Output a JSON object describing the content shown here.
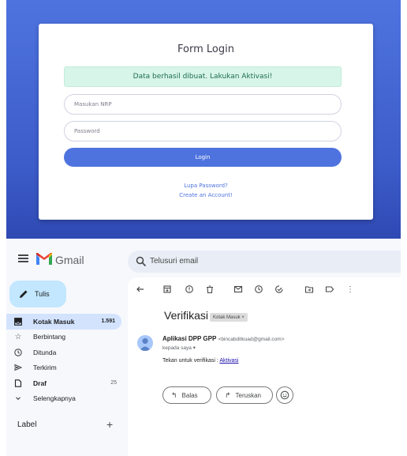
{
  "login": {
    "title": "Form Login",
    "alert": "Data berhasil dibuat. Lakukan Aktivasi!",
    "nrp_placeholder": "Masukan NRP",
    "password_placeholder": "Password",
    "login_button": "Login",
    "forgot_link": "Lupa Password?",
    "create_link": "Create an Account!"
  },
  "gmail": {
    "app_name": "Gmail",
    "search_placeholder": "Telusuri email",
    "compose_label": "Tulis",
    "nav": [
      {
        "label": "Kotak Masuk",
        "count": "1.591",
        "icon": "inbox-icon"
      },
      {
        "label": "Berbintang",
        "count": "",
        "icon": "star-icon"
      },
      {
        "label": "Ditunda",
        "count": "",
        "icon": "clock-icon"
      },
      {
        "label": "Terkirim",
        "count": "",
        "icon": "send-icon"
      },
      {
        "label": "Draf",
        "count": "25",
        "icon": "draft-icon"
      },
      {
        "label": "Selengkapnya",
        "count": "",
        "icon": "chevron-down-icon"
      }
    ],
    "labels_heading": "Label",
    "email": {
      "subject": "Verifikasi",
      "badge": "Kotak Masuk ×",
      "sender_name": "Aplikasi DPP GPP",
      "sender_email": "<bincabditkuad@gmail.com>",
      "recipient": "kepada saya ▾",
      "body_text": "Tekan untuk verifikasi : ",
      "body_link": "Aktivasi"
    },
    "reply_label": "Balas",
    "forward_label": "Teruskan",
    "colors": {
      "accent": "#4e73df",
      "compose": "#c2e7ff",
      "active_nav": "#d3e3fd"
    }
  }
}
